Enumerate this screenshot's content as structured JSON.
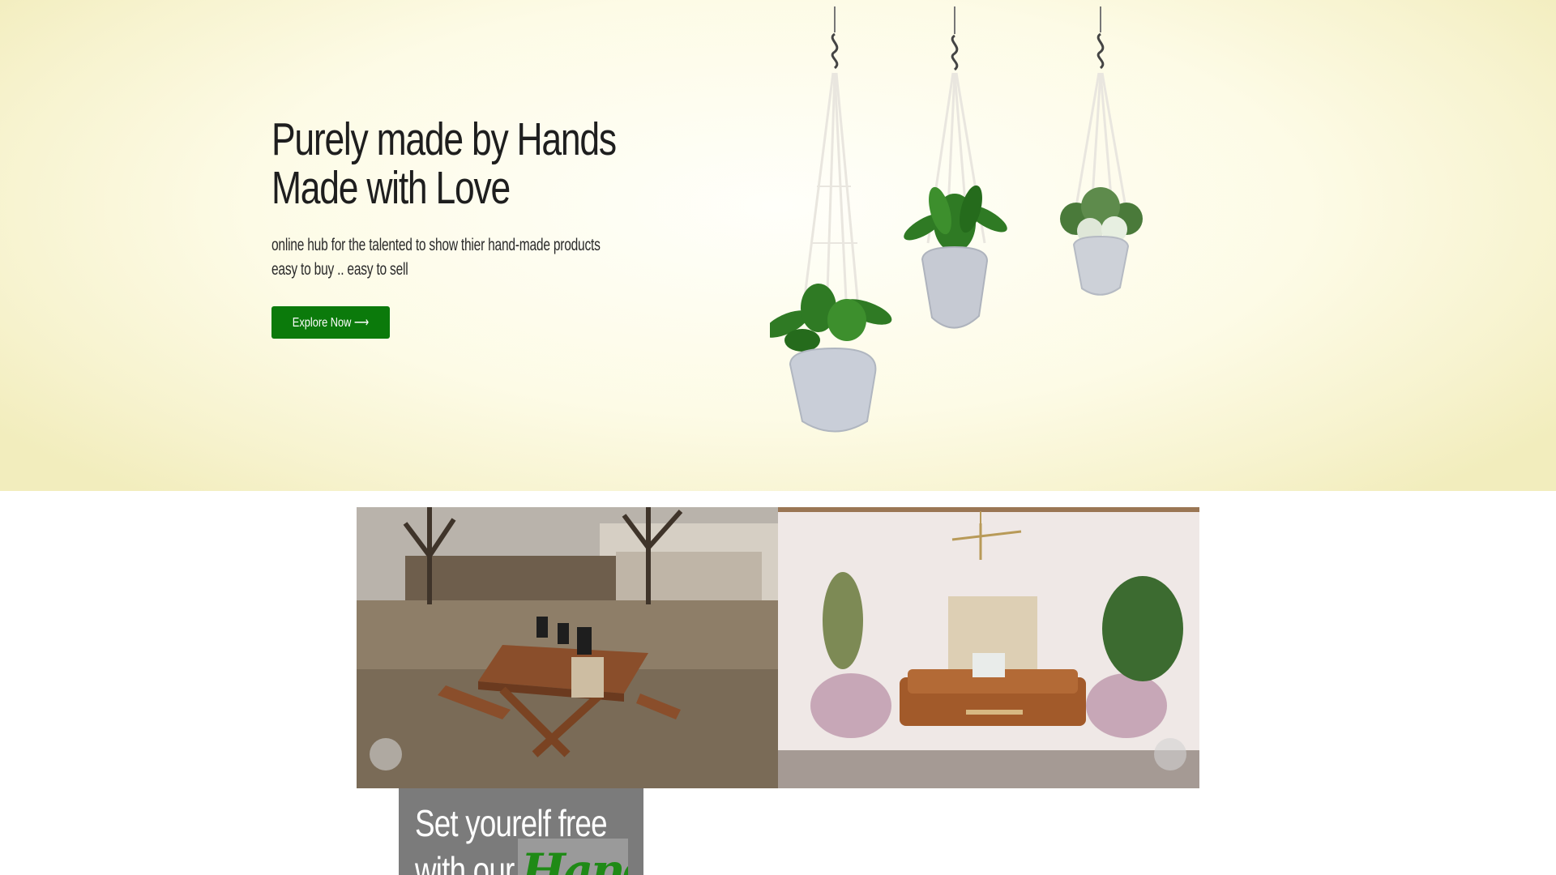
{
  "hero": {
    "title_line1": "Purely made by Hands",
    "title_line2": "Made with Love",
    "subtitle_line1": "online hub for the talented to show thier hand-made products",
    "subtitle_line2": "easy to buy .. easy to sell",
    "cta_label": "Explore Now ⟶",
    "cta_color": "#0b7a0b",
    "background_color": "#fbf8dd"
  },
  "carousel": {
    "slides": [
      {
        "icon": "outdoor-picnic-table-photo"
      },
      {
        "icon": "living-room-macrame-photo"
      }
    ]
  },
  "promo": {
    "line1": "Set yourelf free",
    "line2": "with our",
    "script_word": "Hand",
    "script_color": "#1f8a16"
  }
}
